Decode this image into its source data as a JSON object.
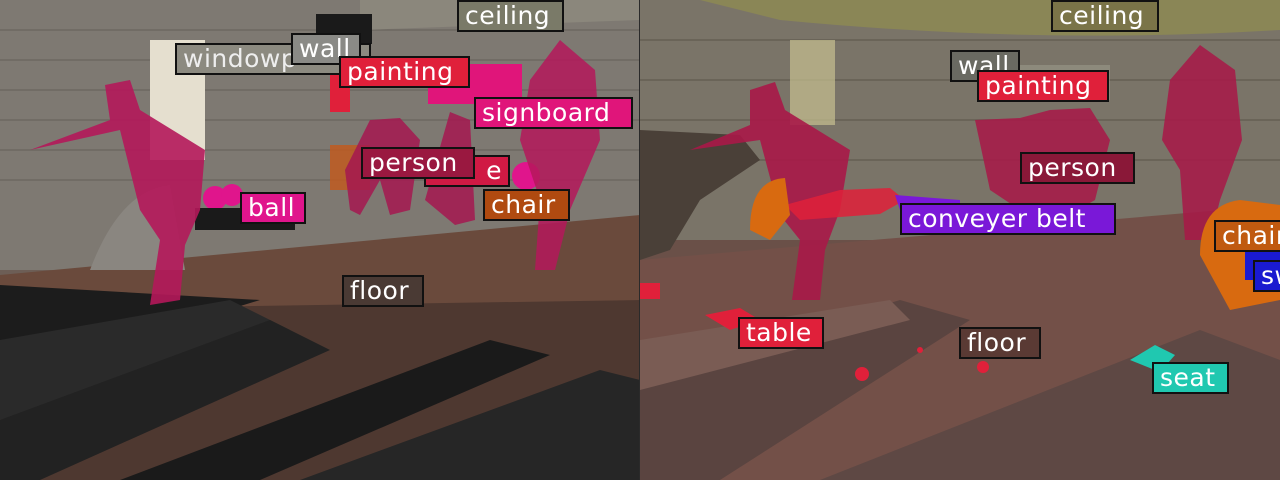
{
  "left_panel": {
    "labels": {
      "window": {
        "text": "windowp",
        "bg": "#8c8a80",
        "fg": "#eeeeee"
      },
      "wall": {
        "text": "wall",
        "bg": "#8a8a86",
        "fg": "#ffffff"
      },
      "ceiling": {
        "text": "ceiling",
        "bg": "#7a7a68",
        "fg": "#ffffff"
      },
      "painting": {
        "text": "painting",
        "bg": "#e0203a",
        "fg": "#ffffff"
      },
      "signboard": {
        "text": "signboard",
        "bg": "#e0157a",
        "fg": "#ffffff"
      },
      "person": {
        "text": "person",
        "bg": "#9a1840",
        "fg": "#ffffff"
      },
      "table": {
        "text": "e",
        "bg": "#d01a44",
        "fg": "#ffffff"
      },
      "chair": {
        "text": "chair",
        "bg": "#b04a10",
        "fg": "#ffffff"
      },
      "ball": {
        "text": "ball",
        "bg": "#e0158c",
        "fg": "#ffffff"
      },
      "floor": {
        "text": "floor",
        "bg": "#4a3a34",
        "fg": "#ffffff"
      }
    }
  },
  "right_panel": {
    "labels": {
      "ceiling": {
        "text": "ceiling",
        "bg": "#7a7448",
        "fg": "#ffffff"
      },
      "wall": {
        "text": "wall",
        "bg": "#6a6a62",
        "fg": "#ffffff"
      },
      "painting": {
        "text": "painting",
        "bg": "#e0203a",
        "fg": "#ffffff"
      },
      "person": {
        "text": "person",
        "bg": "#8a1838",
        "fg": "#ffffff"
      },
      "conveyer_belt": {
        "text": "conveyer belt",
        "bg": "#7a18d8",
        "fg": "#ffffff"
      },
      "chair": {
        "text": "chair",
        "bg": "#c05a10",
        "fg": "#ffffff"
      },
      "sw": {
        "text": "sw",
        "bg": "#1a1ad0",
        "fg": "#ffffff"
      },
      "table": {
        "text": "table",
        "bg": "#e0203a",
        "fg": "#ffffff"
      },
      "floor": {
        "text": "floor",
        "bg": "#5a3a34",
        "fg": "#ffffff"
      },
      "seat": {
        "text": "seat",
        "bg": "#20c8b0",
        "fg": "#ffffff"
      }
    }
  }
}
